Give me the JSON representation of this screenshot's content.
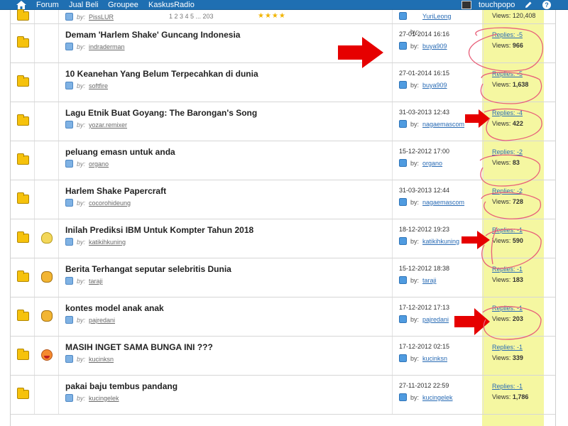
{
  "topbar": {
    "nav": [
      "Forum",
      "Jual Beli",
      "Groupee",
      "KaskusRadio"
    ],
    "username": "touchpopo",
    "help_label": "?"
  },
  "partial_row": {
    "by_label": "by:",
    "author": "PissLUR",
    "pager": "1 2 3 4 5 ... 203",
    "stars": "★★★★",
    "last_user": "YuriLeong",
    "views": "Views: 120,408"
  },
  "threads": [
    {
      "title": "Demam 'Harlem Shake' Guncang Indonesia",
      "author": "indraderman",
      "date": "27-01-2014 16:16",
      "last_user": "buya909",
      "replies": "Replies: -5",
      "views": "966",
      "icon": "none"
    },
    {
      "title": "10 Keanehan Yang Belum Terpecahkan di dunia",
      "author": "softfire",
      "date": "27-01-2014 16:15",
      "last_user": "buya909",
      "replies": "Replies: -5",
      "views": "1,638",
      "icon": "none"
    },
    {
      "title": "Lagu Etnik Buat Goyang: The Barongan's Song",
      "author": "yozar.remixer",
      "date": "31-03-2013 12:43",
      "last_user": "nagaemascom",
      "replies": "Replies: -4",
      "views": "422",
      "icon": "none"
    },
    {
      "title": "peluang emasn untuk anda",
      "author": "organo",
      "date": "15-12-2012 17:00",
      "last_user": "organo",
      "replies": "Replies: -2",
      "views": "83",
      "icon": "none"
    },
    {
      "title": "Harlem Shake Papercraft",
      "author": "cocorohideung",
      "date": "31-03-2013 12:44",
      "last_user": "nagaemascom",
      "replies": "Replies: -2",
      "views": "728",
      "icon": "none"
    },
    {
      "title": "Inilah Prediksi IBM Untuk Kompter Tahun 2018",
      "author": "katikihkuning",
      "date": "18-12-2012 19:23",
      "last_user": "katikihkuning",
      "replies": "Replies: -1",
      "views": "590",
      "icon": "bulb"
    },
    {
      "title": "Berita Terhangat seputar selebritis Dunia",
      "author": "taraji",
      "date": "15-12-2012 18:38",
      "last_user": "taraji",
      "replies": "Replies: -1",
      "views": "183",
      "icon": "thumb"
    },
    {
      "title": "kontes model anak anak",
      "author": "pajredani",
      "date": "17-12-2012 17:13",
      "last_user": "pajredani",
      "replies": "Replies: -1",
      "views": "203",
      "icon": "thumb"
    },
    {
      "title": "MASIH INGET SAMA BUNGA INI ???",
      "author": "kucinksn",
      "date": "17-12-2012 02:15",
      "last_user": "kucinksn",
      "replies": "Replies: -1",
      "views": "339",
      "icon": "smile"
    },
    {
      "title": "pakai baju tembus pandang",
      "author": "kucingelek",
      "date": "27-11-2012 22:59",
      "last_user": "kucingelek",
      "replies": "Replies: -1",
      "views": "1,786",
      "icon": "none"
    }
  ],
  "labels": {
    "by": "by:",
    "by_short": "by:",
    "views_prefix": "Views:"
  },
  "colors": {
    "topbar": "#1f6fb2",
    "highlight": "#f5f7a1",
    "annotation": "#e60000",
    "link": "#2a6cb5"
  }
}
